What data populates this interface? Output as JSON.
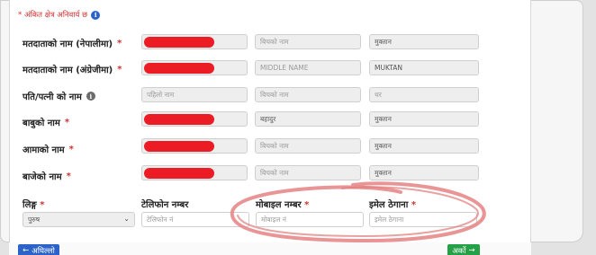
{
  "form": {
    "required_note": "* अंकित क्षेत्र अनिवार्य छ",
    "rows": [
      {
        "label": "मतदाताको नाम (नेपालीमा)",
        "star": "*",
        "first": "",
        "middle": "बिचको नाम",
        "last": "मुक्तान"
      },
      {
        "label": "मतदाताको नाम (अंग्रेजीमा)",
        "star": "*",
        "first": "",
        "middle": "MIDDLE NAME",
        "last": "MUKTAN"
      },
      {
        "label": "पति/पत्नी को नाम",
        "star": "",
        "first": "पहिलो नाम",
        "middle": "बिचको नाम",
        "last": "थर"
      },
      {
        "label": "बाबुको नाम",
        "star": "*",
        "first": "",
        "middle": "बहादुर",
        "last": "मुक्तान"
      },
      {
        "label": "आमाको नाम",
        "star": "*",
        "first": "",
        "middle": "बिचको नाम",
        "last": "मुक्तान"
      },
      {
        "label": "बाजेको नाम",
        "star": "*",
        "first": "",
        "middle": "बिचको नाम",
        "last": "मुक्तान"
      }
    ],
    "bottom": {
      "gender_label": "लिङ्ग",
      "gender_value": "पुरुष",
      "phone_label": "टेलिफोन नम्बर",
      "phone_placeholder": "टेलिफोन नं",
      "mobile_label": "मोबाइल नम्बर",
      "mobile_placeholder": "मोबाइल नं",
      "email_label": "इमेल ठेगाना",
      "email_placeholder": "इमेल ठेगाना",
      "star": "*"
    },
    "buttons": {
      "prev": "अघिल्लो",
      "next": "अर्को"
    }
  },
  "colors": {
    "required": "#d23232",
    "redaction": "#ec1c24",
    "primary": "#2b63c9",
    "success": "#24a046",
    "annotation": "#e88a8a"
  },
  "icons": [
    "info-icon",
    "arrow-left-icon",
    "arrow-right-icon",
    "chevron-down-icon"
  ]
}
